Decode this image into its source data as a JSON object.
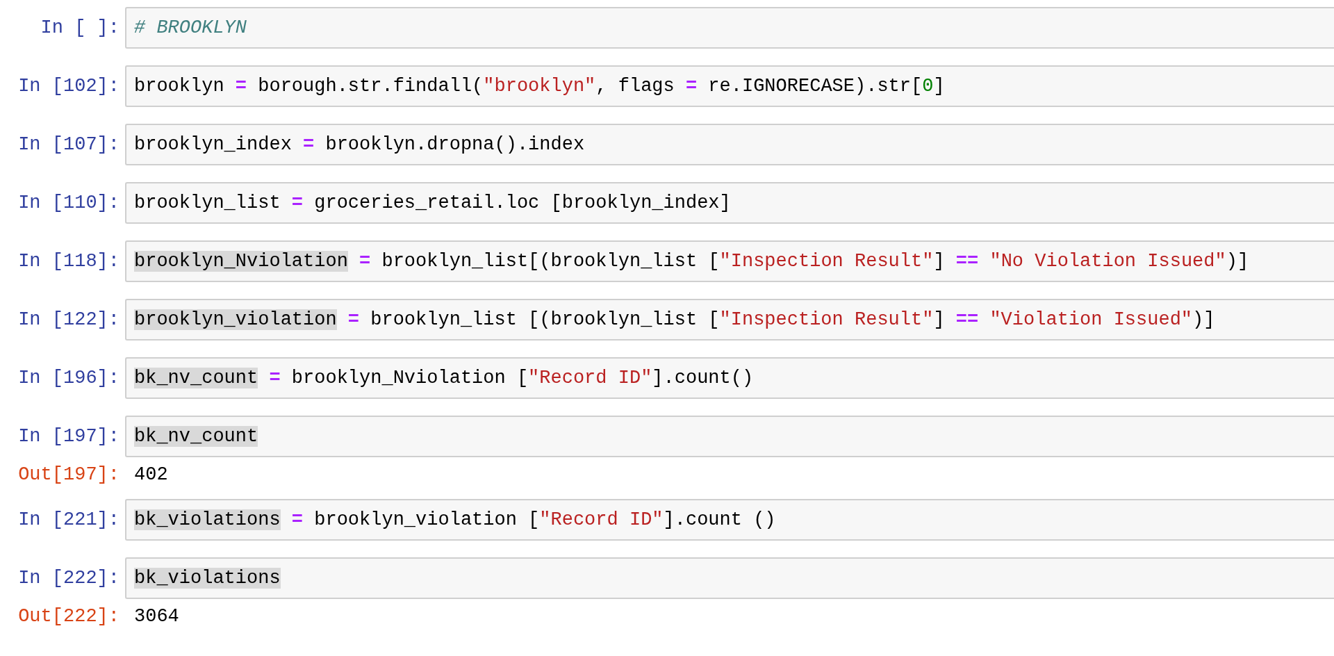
{
  "cells": [
    {
      "prompt": "In [ ]:",
      "tokens": [
        {
          "text": "# BROOKLYN",
          "kind": "comment"
        }
      ]
    },
    {
      "prompt": "In [102]:",
      "tokens": [
        {
          "text": "brooklyn ",
          "kind": "plain"
        },
        {
          "text": "=",
          "kind": "operator"
        },
        {
          "text": " borough.str.findall(",
          "kind": "plain"
        },
        {
          "text": "\"brooklyn\"",
          "kind": "string"
        },
        {
          "text": ", flags ",
          "kind": "plain"
        },
        {
          "text": "=",
          "kind": "operator"
        },
        {
          "text": " re.IGNORECASE).str[",
          "kind": "plain"
        },
        {
          "text": "0",
          "kind": "number"
        },
        {
          "text": "]",
          "kind": "plain"
        }
      ]
    },
    {
      "prompt": "In [107]:",
      "tokens": [
        {
          "text": "brooklyn_index ",
          "kind": "plain"
        },
        {
          "text": "=",
          "kind": "operator"
        },
        {
          "text": " brooklyn.dropna().index",
          "kind": "plain"
        }
      ]
    },
    {
      "prompt": "In [110]:",
      "tokens": [
        {
          "text": "brooklyn_list ",
          "kind": "plain"
        },
        {
          "text": "=",
          "kind": "operator"
        },
        {
          "text": " groceries_retail.loc [brooklyn_index]",
          "kind": "plain"
        }
      ]
    },
    {
      "prompt": "In [118]:",
      "tokens": [
        {
          "text": "brooklyn_Nviolation",
          "kind": "match"
        },
        {
          "text": " =",
          "kind": "operator"
        },
        {
          "text": " brooklyn_list[(brooklyn_list [",
          "kind": "plain"
        },
        {
          "text": "\"Inspection Result\"",
          "kind": "string"
        },
        {
          "text": "]",
          "kind": "plain"
        },
        {
          "text": " == ",
          "kind": "operator"
        },
        {
          "text": "\"No Violation Issued\"",
          "kind": "string"
        },
        {
          "text": ")]",
          "kind": "plain"
        }
      ]
    },
    {
      "prompt": "In [122]:",
      "tokens": [
        {
          "text": "brooklyn_violation",
          "kind": "match"
        },
        {
          "text": " =",
          "kind": "operator"
        },
        {
          "text": " brooklyn_list [(brooklyn_list [",
          "kind": "plain"
        },
        {
          "text": "\"Inspection Result\"",
          "kind": "string"
        },
        {
          "text": "]",
          "kind": "plain"
        },
        {
          "text": " == ",
          "kind": "operator"
        },
        {
          "text": "\"Violation Issued\"",
          "kind": "string"
        },
        {
          "text": ")]",
          "kind": "plain"
        }
      ]
    },
    {
      "prompt": "In [196]:",
      "tokens": [
        {
          "text": "bk_nv_count",
          "kind": "match"
        },
        {
          "text": " =",
          "kind": "operator"
        },
        {
          "text": " brooklyn_Nviolation [",
          "kind": "plain"
        },
        {
          "text": "\"Record ID\"",
          "kind": "string"
        },
        {
          "text": "].count()",
          "kind": "plain"
        }
      ]
    },
    {
      "prompt": "In [197]:",
      "tokens": [
        {
          "text": "bk_nv_count",
          "kind": "match"
        }
      ],
      "output": {
        "prompt": "Out[197]:",
        "text": "402"
      }
    },
    {
      "prompt": "In [221]:",
      "tokens": [
        {
          "text": "bk_violations",
          "kind": "match"
        },
        {
          "text": " =",
          "kind": "operator"
        },
        {
          "text": " brooklyn_violation [",
          "kind": "plain"
        },
        {
          "text": "\"Record ID\"",
          "kind": "string"
        },
        {
          "text": "].count ()",
          "kind": "plain"
        }
      ]
    },
    {
      "prompt": "In [222]:",
      "tokens": [
        {
          "text": "bk_violations",
          "kind": "match"
        }
      ],
      "output": {
        "prompt": "Out[222]:",
        "text": "3064"
      }
    }
  ]
}
